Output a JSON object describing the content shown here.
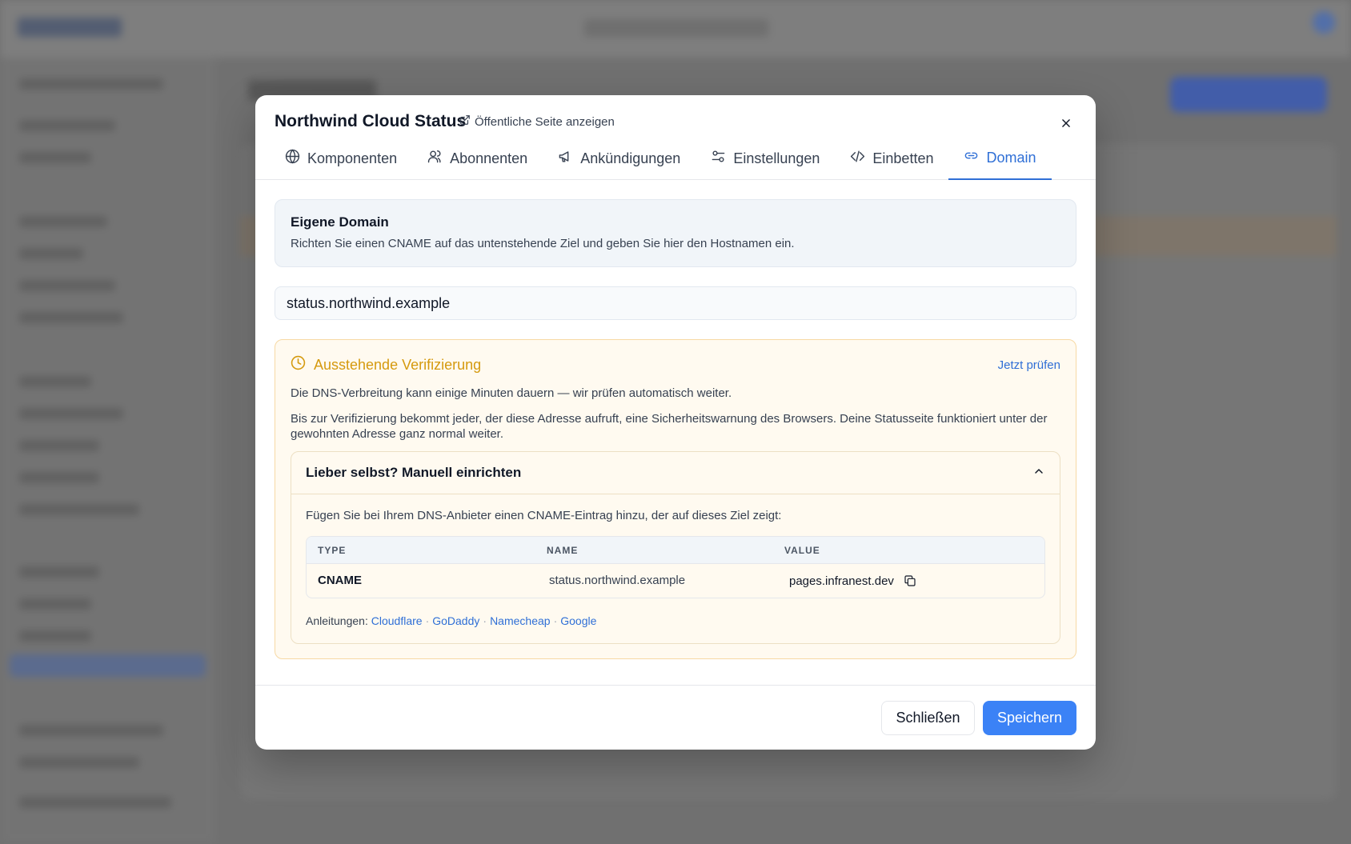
{
  "modal": {
    "title": "Northwind Cloud Status",
    "public_link_label": "Öffentliche Seite anzeigen"
  },
  "tabs": [
    {
      "label": "Komponenten",
      "icon": "globe-icon"
    },
    {
      "label": "Abonnenten",
      "icon": "users-icon"
    },
    {
      "label": "Ankündigungen",
      "icon": "megaphone-icon"
    },
    {
      "label": "Einstellungen",
      "icon": "sliders-icon"
    },
    {
      "label": "Einbetten",
      "icon": "code-icon"
    },
    {
      "label": "Domain",
      "icon": "link-icon",
      "active": true
    }
  ],
  "custom_domain": {
    "title": "Eigene Domain",
    "description": "Richten Sie einen CNAME auf das untenstehende Ziel und geben Sie hier den Hostnamen ein.",
    "hostname_value": "status.northwind.example"
  },
  "verification": {
    "status_label": "Ausstehende Verifizierung",
    "status_color": "#d59a0f",
    "check_now_label": "Jetzt prüfen",
    "propagation_text": "Die DNS-Verbreitung kann einige Minuten dauern — wir prüfen automatisch weiter.",
    "warning_text": "Bis zur Verifizierung bekommt jeder, der diese Adresse aufruft, eine Sicherheitswarnung des Browsers. Deine Statusseite funktioniert unter der gewohnten Adresse ganz normal weiter."
  },
  "manual_setup": {
    "title": "Lieber selbst? Manuell einrichten",
    "expanded": true,
    "instruction": "Fügen Sie bei Ihrem DNS-Anbieter einen CNAME-Eintrag hinzu, der auf dieses Ziel zeigt:",
    "table": {
      "headers": [
        "TYPE",
        "NAME",
        "VALUE"
      ],
      "row": {
        "type": "CNAME",
        "name": "status.northwind.example",
        "value": "pages.infranest.dev"
      }
    },
    "guides_label": "Anleitungen:",
    "guides": [
      "Cloudflare",
      "GoDaddy",
      "Namecheap",
      "Google"
    ]
  },
  "footer": {
    "close_label": "Schließen",
    "save_label": "Speichern"
  },
  "colors": {
    "accent": "#2f6fd6",
    "primary_button": "#3b82f6",
    "pending_border": "#f7d9a4"
  }
}
